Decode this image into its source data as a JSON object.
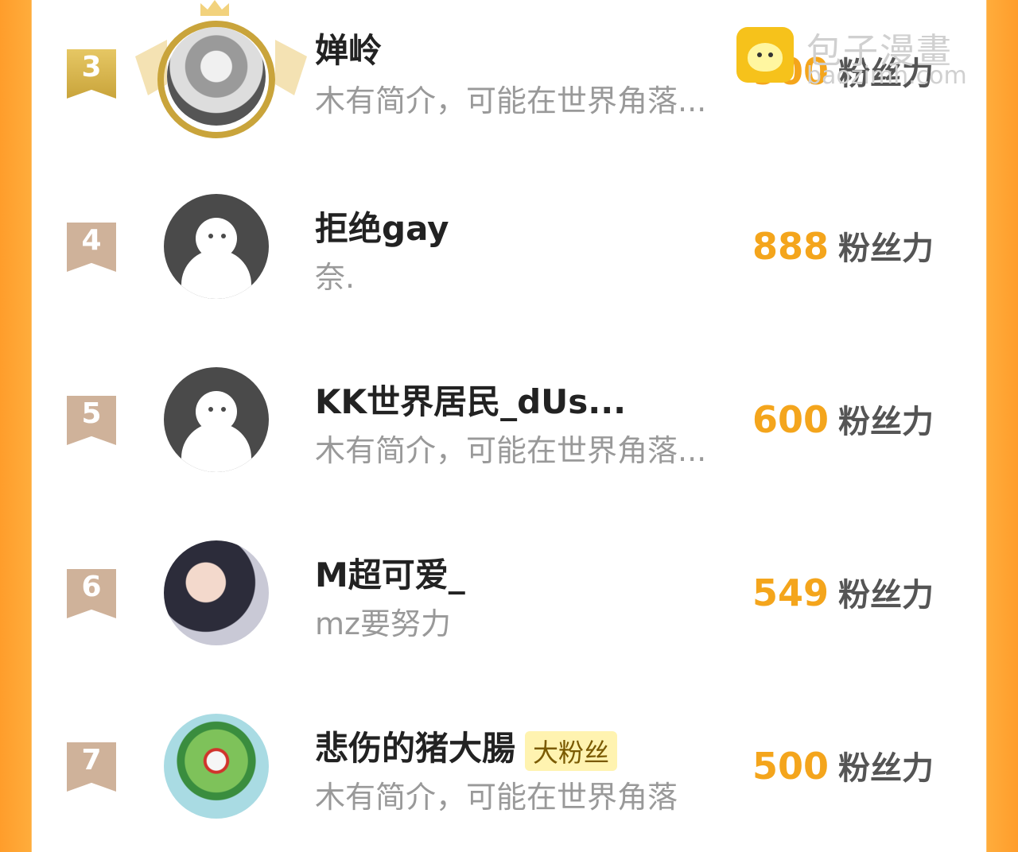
{
  "watermark": {
    "title": "包子漫畫",
    "domain": "baozimh.com"
  },
  "rows": [
    {
      "rank": "3",
      "name": "婵岭",
      "intro": "木有简介，可能在世界角落...",
      "score": "900",
      "unit": "粉丝力"
    },
    {
      "rank": "4",
      "name": "拒绝gay",
      "intro": "奈.",
      "score": "888",
      "unit": "粉丝力"
    },
    {
      "rank": "5",
      "name": "KK世界居民_dUs...",
      "intro": "木有简介，可能在世界角落...",
      "score": "600",
      "unit": "粉丝力"
    },
    {
      "rank": "6",
      "name": "M超可爱_",
      "intro": "mz要努力",
      "score": "549",
      "unit": "粉丝力"
    },
    {
      "rank": "7",
      "name": "悲伤的猪大腸",
      "badge": "大粉丝",
      "intro": "木有简介，可能在世界角落",
      "score": "500",
      "unit": "粉丝力"
    }
  ],
  "colors": {
    "accent": "#f4a51c",
    "border_orange": "#ff9d2b",
    "rank_gold": "#c9a43b",
    "rank_default": "#cfb29a"
  }
}
